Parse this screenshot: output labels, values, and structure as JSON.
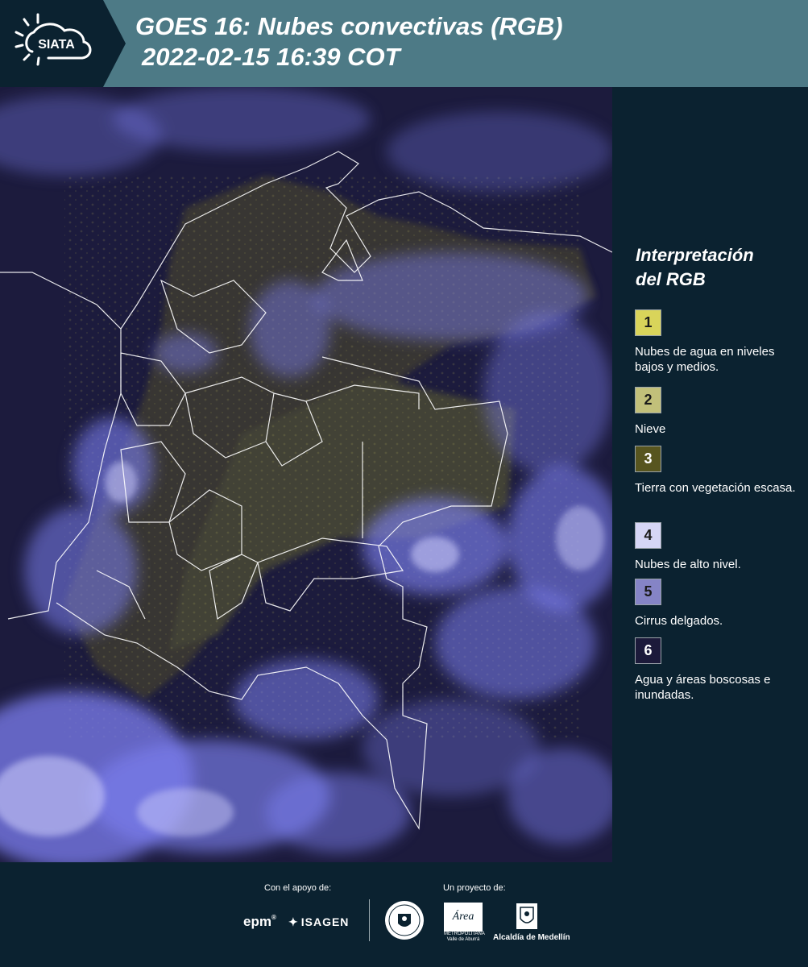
{
  "header": {
    "logo_text": "SIATA",
    "title_line1": "GOES 16: Nubes convectivas (RGB)",
    "title_line2": "2022-02-15 16:39 COT"
  },
  "legend": {
    "title_line1": "Interpretación",
    "title_line2": "del RGB",
    "items": [
      {
        "number": "1",
        "label": "Nubes de agua en niveles bajos y medios.",
        "color": "#d9d45a"
      },
      {
        "number": "2",
        "label": "Nieve",
        "color": "#c2c07a"
      },
      {
        "number": "3",
        "label": "Tierra con vegetación escasa.",
        "color": "#57551f"
      },
      {
        "number": "4",
        "label": "Nubes de alto nivel.",
        "color": "#d6d6f6"
      },
      {
        "number": "5",
        "label": "Cirrus delgados.",
        "color": "#8584c6"
      },
      {
        "number": "6",
        "label": "Agua y áreas boscosas e inundadas.",
        "color": "#1c1a3a"
      }
    ]
  },
  "footer": {
    "support_label": "Con el apoyo de:",
    "project_label": "Un proyecto de:",
    "epm_text": "epm",
    "isagen_text": "ISAGEN",
    "area_text": "Área",
    "area_sub": "METROPOLITANA",
    "area_sub2": "Valle de Aburrá",
    "alcaldia_text": "Alcaldía de Medellín"
  },
  "colors": {
    "header_bg": "#4d7a86",
    "panel_bg": "#0b2230",
    "map_bg": "#1c1b3d",
    "cloud": "#7c7ff0",
    "land_yellow": "#8c8a3a"
  }
}
